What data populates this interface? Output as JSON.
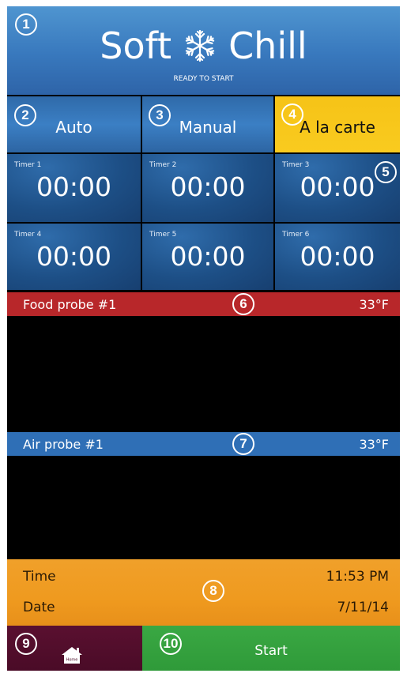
{
  "header": {
    "title_left": "Soft",
    "title_right": "Chill",
    "icon": "snowflake-icon",
    "status": "READY TO START",
    "badge": "1"
  },
  "modes": [
    {
      "label": "Auto",
      "badge": "2",
      "active": false
    },
    {
      "label": "Manual",
      "badge": "3",
      "active": false
    },
    {
      "label": "A la carte",
      "badge": "4",
      "active": true
    }
  ],
  "timers": [
    {
      "label": "Timer 1",
      "value": "00:00"
    },
    {
      "label": "Timer 2",
      "value": "00:00"
    },
    {
      "label": "Timer 3",
      "value": "00:00"
    },
    {
      "label": "Timer 4",
      "value": "00:00"
    },
    {
      "label": "Timer 5",
      "value": "00:00"
    },
    {
      "label": "Timer 6",
      "value": "00:00"
    }
  ],
  "timers_badge": "5",
  "food_probe": {
    "name": "Food probe #1",
    "value": "33°F",
    "badge": "6",
    "color": "#b8272a"
  },
  "air_probe": {
    "name": "Air probe #1",
    "value": "33°F",
    "badge": "7",
    "color": "#2f6fb6"
  },
  "timedate": {
    "time_label": "Time",
    "time_value": "11:53 PM",
    "date_label": "Date",
    "date_value": "7/11/14",
    "badge": "8"
  },
  "home": {
    "icon": "home-icon",
    "label": "Home",
    "badge": "9"
  },
  "start": {
    "label": "Start",
    "badge": "10"
  },
  "colors": {
    "header_blue": "#3878bd",
    "active_yellow": "#f9cb1f",
    "orange": "#ef9a1f",
    "maroon": "#4a0b27",
    "green": "#2f9a39"
  }
}
